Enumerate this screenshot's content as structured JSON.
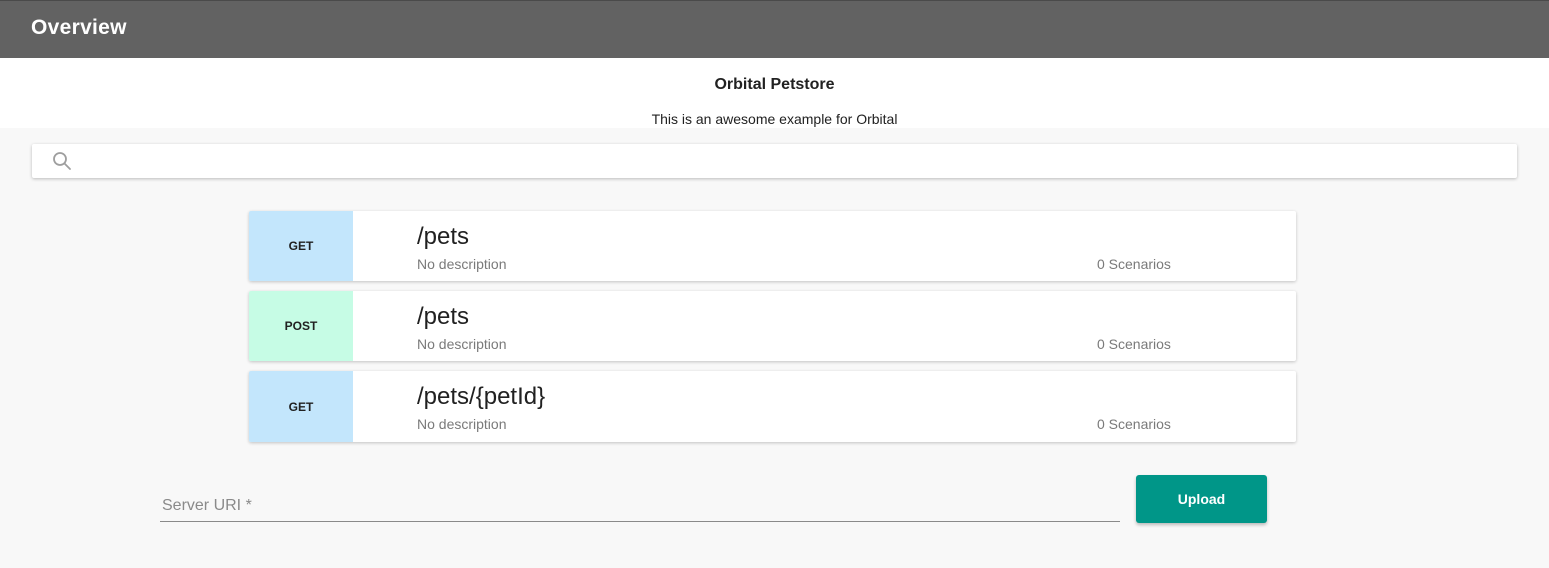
{
  "appbar": {
    "title": "Overview"
  },
  "api": {
    "title": "Orbital Petstore",
    "description": "This is an awesome example for Orbital"
  },
  "search": {
    "value": "",
    "placeholder": "",
    "icon": "search-icon"
  },
  "endpoints": [
    {
      "method": "GET",
      "method_color": "#c3e6fc",
      "path": "/pets",
      "description": "No description",
      "scenarios": "0 Scenarios"
    },
    {
      "method": "POST",
      "method_color": "#c6fce5",
      "path": "/pets",
      "description": "No description",
      "scenarios": "0 Scenarios"
    },
    {
      "method": "GET",
      "method_color": "#c3e6fc",
      "path": "/pets/{petId}",
      "description": "No description",
      "scenarios": "0 Scenarios"
    }
  ],
  "server_uri": {
    "label": "Server URI *",
    "value": ""
  },
  "upload": {
    "label": "Upload",
    "color": "#009688"
  },
  "colors": {
    "appbar": "#626262",
    "accent": "#009688"
  }
}
